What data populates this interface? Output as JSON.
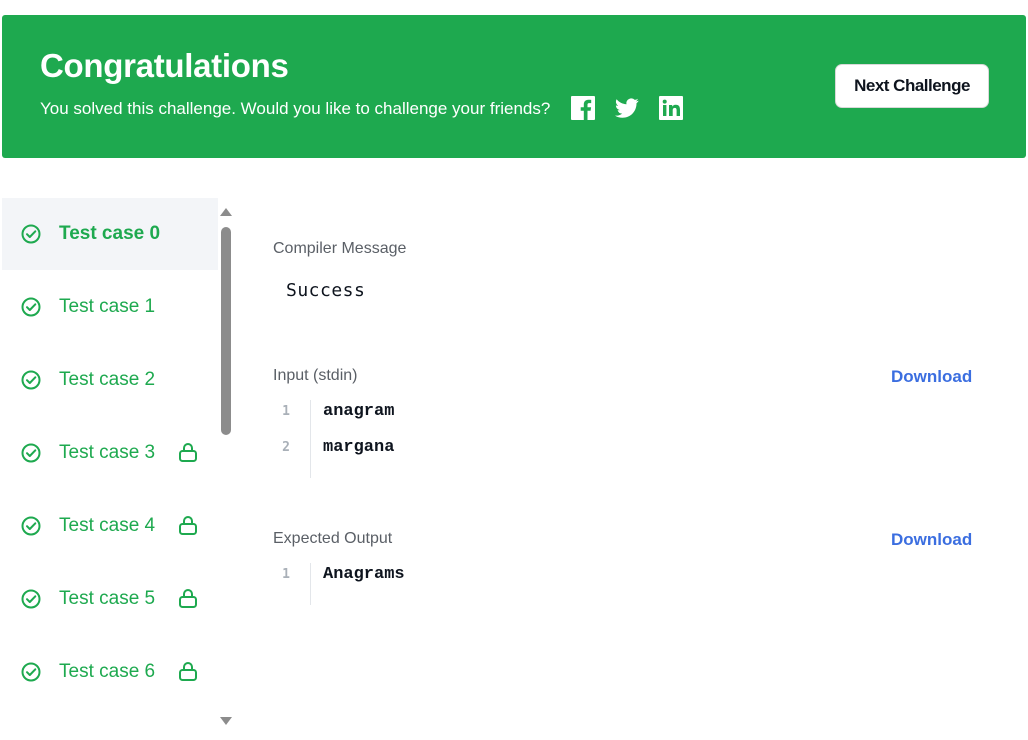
{
  "banner": {
    "title": "Congratulations",
    "subtitle": "You solved this challenge. Would you like to challenge your friends?",
    "share_icons": [
      "facebook-icon",
      "twitter-icon",
      "linkedin-icon"
    ],
    "next_button": "Next Challenge",
    "color": "#1ea94f"
  },
  "test_cases": [
    {
      "label": "Test case 0",
      "status": "passed",
      "locked": false,
      "active": true
    },
    {
      "label": "Test case 1",
      "status": "passed",
      "locked": false,
      "active": false
    },
    {
      "label": "Test case 2",
      "status": "passed",
      "locked": false,
      "active": false
    },
    {
      "label": "Test case 3",
      "status": "passed",
      "locked": true,
      "active": false
    },
    {
      "label": "Test case 4",
      "status": "passed",
      "locked": true,
      "active": false
    },
    {
      "label": "Test case 5",
      "status": "passed",
      "locked": true,
      "active": false
    },
    {
      "label": "Test case 6",
      "status": "passed",
      "locked": true,
      "active": false
    }
  ],
  "result": {
    "compiler_label": "Compiler Message",
    "compiler_message": "Success",
    "input_label": "Input (stdin)",
    "input_download": "Download",
    "input_lines": [
      "anagram",
      "margana"
    ],
    "output_label": "Expected Output",
    "output_download": "Download",
    "output_lines": [
      "Anagrams"
    ]
  },
  "colors": {
    "success": "#1ea94f",
    "link": "#3b6ee0",
    "active_row": "#f3f5f8"
  }
}
